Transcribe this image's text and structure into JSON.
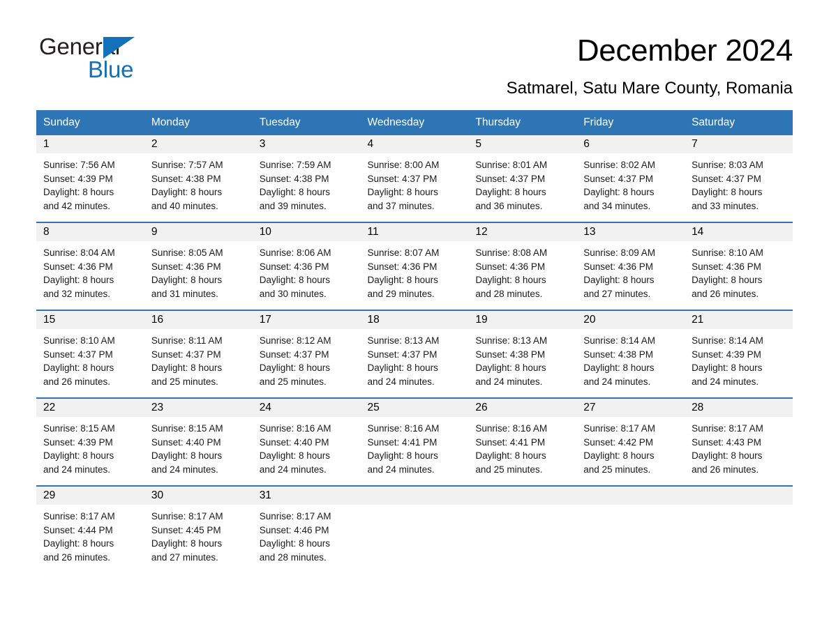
{
  "brand": {
    "name_part1": "General",
    "name_part2": "Blue",
    "accent_color": "#1271b8",
    "triangle_icon": "triangle-right-icon"
  },
  "header": {
    "title": "December 2024",
    "subtitle": "Satmarel, Satu Mare County, Romania"
  },
  "theme": {
    "header_blue": "#2e75b6",
    "daynum_band": "#f1f1f1",
    "row_divider": "#2e75b6"
  },
  "calendar": {
    "weekday_headers": [
      "Sunday",
      "Monday",
      "Tuesday",
      "Wednesday",
      "Thursday",
      "Friday",
      "Saturday"
    ],
    "weeks": [
      [
        {
          "day": "1",
          "info": "Sunrise: 7:56 AM\nSunset: 4:39 PM\nDaylight: 8 hours\nand 42 minutes."
        },
        {
          "day": "2",
          "info": "Sunrise: 7:57 AM\nSunset: 4:38 PM\nDaylight: 8 hours\nand 40 minutes."
        },
        {
          "day": "3",
          "info": "Sunrise: 7:59 AM\nSunset: 4:38 PM\nDaylight: 8 hours\nand 39 minutes."
        },
        {
          "day": "4",
          "info": "Sunrise: 8:00 AM\nSunset: 4:37 PM\nDaylight: 8 hours\nand 37 minutes."
        },
        {
          "day": "5",
          "info": "Sunrise: 8:01 AM\nSunset: 4:37 PM\nDaylight: 8 hours\nand 36 minutes."
        },
        {
          "day": "6",
          "info": "Sunrise: 8:02 AM\nSunset: 4:37 PM\nDaylight: 8 hours\nand 34 minutes."
        },
        {
          "day": "7",
          "info": "Sunrise: 8:03 AM\nSunset: 4:37 PM\nDaylight: 8 hours\nand 33 minutes."
        }
      ],
      [
        {
          "day": "8",
          "info": "Sunrise: 8:04 AM\nSunset: 4:36 PM\nDaylight: 8 hours\nand 32 minutes."
        },
        {
          "day": "9",
          "info": "Sunrise: 8:05 AM\nSunset: 4:36 PM\nDaylight: 8 hours\nand 31 minutes."
        },
        {
          "day": "10",
          "info": "Sunrise: 8:06 AM\nSunset: 4:36 PM\nDaylight: 8 hours\nand 30 minutes."
        },
        {
          "day": "11",
          "info": "Sunrise: 8:07 AM\nSunset: 4:36 PM\nDaylight: 8 hours\nand 29 minutes."
        },
        {
          "day": "12",
          "info": "Sunrise: 8:08 AM\nSunset: 4:36 PM\nDaylight: 8 hours\nand 28 minutes."
        },
        {
          "day": "13",
          "info": "Sunrise: 8:09 AM\nSunset: 4:36 PM\nDaylight: 8 hours\nand 27 minutes."
        },
        {
          "day": "14",
          "info": "Sunrise: 8:10 AM\nSunset: 4:36 PM\nDaylight: 8 hours\nand 26 minutes."
        }
      ],
      [
        {
          "day": "15",
          "info": "Sunrise: 8:10 AM\nSunset: 4:37 PM\nDaylight: 8 hours\nand 26 minutes."
        },
        {
          "day": "16",
          "info": "Sunrise: 8:11 AM\nSunset: 4:37 PM\nDaylight: 8 hours\nand 25 minutes."
        },
        {
          "day": "17",
          "info": "Sunrise: 8:12 AM\nSunset: 4:37 PM\nDaylight: 8 hours\nand 25 minutes."
        },
        {
          "day": "18",
          "info": "Sunrise: 8:13 AM\nSunset: 4:37 PM\nDaylight: 8 hours\nand 24 minutes."
        },
        {
          "day": "19",
          "info": "Sunrise: 8:13 AM\nSunset: 4:38 PM\nDaylight: 8 hours\nand 24 minutes."
        },
        {
          "day": "20",
          "info": "Sunrise: 8:14 AM\nSunset: 4:38 PM\nDaylight: 8 hours\nand 24 minutes."
        },
        {
          "day": "21",
          "info": "Sunrise: 8:14 AM\nSunset: 4:39 PM\nDaylight: 8 hours\nand 24 minutes."
        }
      ],
      [
        {
          "day": "22",
          "info": "Sunrise: 8:15 AM\nSunset: 4:39 PM\nDaylight: 8 hours\nand 24 minutes."
        },
        {
          "day": "23",
          "info": "Sunrise: 8:15 AM\nSunset: 4:40 PM\nDaylight: 8 hours\nand 24 minutes."
        },
        {
          "day": "24",
          "info": "Sunrise: 8:16 AM\nSunset: 4:40 PM\nDaylight: 8 hours\nand 24 minutes."
        },
        {
          "day": "25",
          "info": "Sunrise: 8:16 AM\nSunset: 4:41 PM\nDaylight: 8 hours\nand 24 minutes."
        },
        {
          "day": "26",
          "info": "Sunrise: 8:16 AM\nSunset: 4:41 PM\nDaylight: 8 hours\nand 25 minutes."
        },
        {
          "day": "27",
          "info": "Sunrise: 8:17 AM\nSunset: 4:42 PM\nDaylight: 8 hours\nand 25 minutes."
        },
        {
          "day": "28",
          "info": "Sunrise: 8:17 AM\nSunset: 4:43 PM\nDaylight: 8 hours\nand 26 minutes."
        }
      ],
      [
        {
          "day": "29",
          "info": "Sunrise: 8:17 AM\nSunset: 4:44 PM\nDaylight: 8 hours\nand 26 minutes."
        },
        {
          "day": "30",
          "info": "Sunrise: 8:17 AM\nSunset: 4:45 PM\nDaylight: 8 hours\nand 27 minutes."
        },
        {
          "day": "31",
          "info": "Sunrise: 8:17 AM\nSunset: 4:46 PM\nDaylight: 8 hours\nand 28 minutes."
        },
        {
          "day": "",
          "info": ""
        },
        {
          "day": "",
          "info": ""
        },
        {
          "day": "",
          "info": ""
        },
        {
          "day": "",
          "info": ""
        }
      ]
    ]
  }
}
